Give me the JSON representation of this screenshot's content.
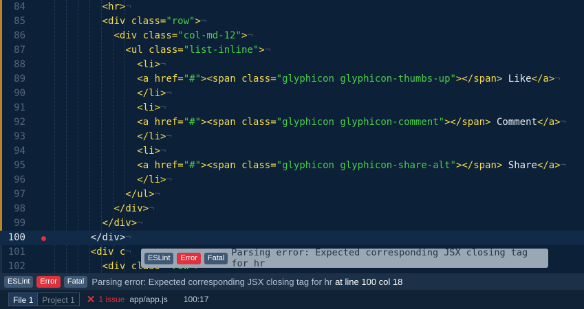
{
  "editor": {
    "lines": [
      {
        "num": "84",
        "indent": 8,
        "segs": [
          [
            "tag",
            "<hr>"
          ]
        ]
      },
      {
        "num": "85",
        "indent": 8,
        "segs": [
          [
            "tag",
            "<div "
          ],
          [
            "attr",
            "class="
          ],
          [
            "str",
            "\"row\""
          ],
          [
            "tag",
            ">"
          ]
        ]
      },
      {
        "num": "86",
        "indent": 10,
        "segs": [
          [
            "tag",
            "<div "
          ],
          [
            "attr",
            "class="
          ],
          [
            "str",
            "\"col-md-12\""
          ],
          [
            "tag",
            ">"
          ]
        ]
      },
      {
        "num": "87",
        "indent": 12,
        "segs": [
          [
            "tag",
            "<ul "
          ],
          [
            "attr",
            "class="
          ],
          [
            "str",
            "\"list-inline\""
          ],
          [
            "tag",
            ">"
          ]
        ]
      },
      {
        "num": "88",
        "indent": 14,
        "segs": [
          [
            "tag",
            "<li>"
          ]
        ]
      },
      {
        "num": "89",
        "indent": 14,
        "segs": [
          [
            "tag",
            "<a "
          ],
          [
            "attr",
            "href="
          ],
          [
            "str",
            "\"#\""
          ],
          [
            "tag",
            "><span "
          ],
          [
            "attr",
            "class="
          ],
          [
            "str",
            "\"glyphicon glyphicon-thumbs-up\""
          ],
          [
            "tag",
            "></span>"
          ],
          [
            "t",
            " Like"
          ],
          [
            "tag",
            "</a>"
          ]
        ]
      },
      {
        "num": "90",
        "indent": 14,
        "segs": [
          [
            "tag",
            "</li>"
          ]
        ]
      },
      {
        "num": "91",
        "indent": 14,
        "segs": [
          [
            "tag",
            "<li>"
          ]
        ]
      },
      {
        "num": "92",
        "indent": 14,
        "segs": [
          [
            "tag",
            "<a "
          ],
          [
            "attr",
            "href="
          ],
          [
            "str",
            "\"#\""
          ],
          [
            "tag",
            "><span "
          ],
          [
            "attr",
            "class="
          ],
          [
            "str",
            "\"glyphicon glyphicon-comment\""
          ],
          [
            "tag",
            "></span>"
          ],
          [
            "t",
            " Comment"
          ],
          [
            "tag",
            "</a>"
          ]
        ]
      },
      {
        "num": "93",
        "indent": 14,
        "segs": [
          [
            "tag",
            "</li>"
          ]
        ]
      },
      {
        "num": "94",
        "indent": 14,
        "segs": [
          [
            "tag",
            "<li>"
          ]
        ]
      },
      {
        "num": "95",
        "indent": 14,
        "segs": [
          [
            "tag",
            "<a "
          ],
          [
            "attr",
            "href="
          ],
          [
            "str",
            "\"#\""
          ],
          [
            "tag",
            "><span "
          ],
          [
            "attr",
            "class="
          ],
          [
            "str",
            "\"glyphicon glyphicon-share-alt\""
          ],
          [
            "tag",
            "></span>"
          ],
          [
            "t",
            " Share"
          ],
          [
            "tag",
            "</a>"
          ]
        ]
      },
      {
        "num": "96",
        "indent": 14,
        "segs": [
          [
            "tag",
            "</li>"
          ]
        ]
      },
      {
        "num": "97",
        "indent": 12,
        "segs": [
          [
            "tag",
            "</ul>"
          ]
        ]
      },
      {
        "num": "98",
        "indent": 10,
        "segs": [
          [
            "tag",
            "</div>"
          ]
        ]
      },
      {
        "num": "99",
        "indent": 8,
        "segs": [
          [
            "tag",
            "</div>"
          ]
        ]
      },
      {
        "num": "100",
        "indent": 6,
        "segs": [
          [
            "t",
            "</div>"
          ]
        ],
        "current": true,
        "error": true
      },
      {
        "num": "101",
        "indent": 6,
        "segs": [
          [
            "tag",
            "<div "
          ],
          [
            "attr",
            "c"
          ]
        ]
      },
      {
        "num": "102",
        "indent": 8,
        "segs": [
          [
            "tag",
            "<div "
          ],
          [
            "attr",
            "class="
          ],
          [
            "str",
            "\"row\""
          ],
          [
            "tag",
            ">"
          ]
        ]
      }
    ],
    "invisible_char": "¬"
  },
  "tooltip": {
    "badges": {
      "linter": "ESLint",
      "severity": "Error",
      "kind": "Fatal"
    },
    "message": "Parsing error: Expected corresponding JSX closing tag for hr"
  },
  "message_bar": {
    "badges": {
      "linter": "ESLint",
      "severity": "Error",
      "kind": "Fatal"
    },
    "message": "Parsing error: Expected corresponding JSX closing tag for hr",
    "location": "at line 100 col 18"
  },
  "status_bar": {
    "tabs": [
      {
        "label": "File",
        "count": "1",
        "active": true
      },
      {
        "label": "Project",
        "count": "1",
        "active": false
      }
    ],
    "issues_icon": "x-icon",
    "issues_text": "1 issue",
    "file_path": "app/app.js",
    "cursor_position": "100:17"
  },
  "colors": {
    "background": "#0c2038",
    "tag": "#f7dc4d",
    "string": "#49cf49",
    "error": "#e0313c",
    "badge": "#3f5873"
  }
}
